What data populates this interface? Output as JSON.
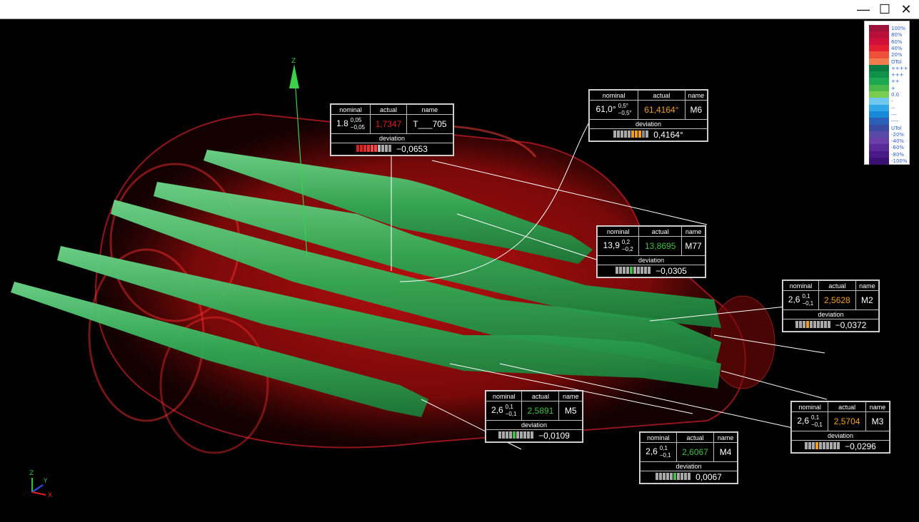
{
  "window": {
    "minimize_glyph": "—",
    "maximize_glyph": "☐",
    "close_glyph": "✕"
  },
  "legend": [
    {
      "label": "100%",
      "color": "#9c1238"
    },
    {
      "label": "80%",
      "color": "#b8103a"
    },
    {
      "label": "60%",
      "color": "#d0103a"
    },
    {
      "label": "40%",
      "color": "#e41e30"
    },
    {
      "label": "20%",
      "color": "#f0503a"
    },
    {
      "label": "OTol",
      "color": "#f47a50"
    },
    {
      "label": "++++",
      "color": "#0a7a40"
    },
    {
      "label": "+++",
      "color": "#109048"
    },
    {
      "label": "++",
      "color": "#1ca850"
    },
    {
      "label": "+",
      "color": "#4ab848"
    },
    {
      "label": "0.0",
      "color": "#7acc50"
    },
    {
      "label": "-",
      "color": "#70c8ee"
    },
    {
      "label": "--",
      "color": "#30a8e8"
    },
    {
      "label": "---",
      "color": "#1888d8"
    },
    {
      "label": "----",
      "color": "#2a60b8"
    },
    {
      "label": "UTol",
      "color": "#3a4aa0"
    },
    {
      "label": "-20%",
      "color": "#5a4aa8"
    },
    {
      "label": "-40%",
      "color": "#6a40a8"
    },
    {
      "label": "-60%",
      "color": "#5a2a98"
    },
    {
      "label": "-80%",
      "color": "#4a1a88"
    },
    {
      "label": "-100%",
      "color": "#3a1070"
    }
  ],
  "axes": {
    "z": "Z",
    "y": "Y",
    "x": "X",
    "main_z": "Z"
  },
  "callout_headers": {
    "nominal": "nominal",
    "actual": "actual",
    "name": "name",
    "deviation": "deviation"
  },
  "callouts": [
    {
      "id": "t705",
      "nominal": "1.8",
      "tol_up": "0,05",
      "tol_down": "−0,05",
      "actual": "1,7347",
      "actual_color": "#e02020",
      "name": "T___705",
      "deviation": "−0,0653",
      "bar": [
        "#c22",
        "#d22",
        "#e22",
        "#e33",
        "#f44",
        "#f44",
        "#bbb",
        "#aaa",
        "#aaa",
        "#999"
      ]
    },
    {
      "id": "m6",
      "nominal": "61,0°",
      "tol_up": "0,5°",
      "tol_down": "−0,5°",
      "actual": "61,4164°",
      "actual_color": "#f0a020",
      "name": "M6",
      "deviation": "0,4164°",
      "bar": [
        "#aaa",
        "#aaa",
        "#aaa",
        "#aaa",
        "#aaa",
        "#f0a020",
        "#f0a020",
        "#f0a020",
        "#888",
        "#aaa"
      ]
    },
    {
      "id": "m77",
      "nominal": "13,9",
      "tol_up": "0,2",
      "tol_down": "−0,2",
      "actual": "13,8695",
      "actual_color": "#40c040",
      "name": "M77",
      "deviation": "−0,0305",
      "bar": [
        "#aaa",
        "#aaa",
        "#aaa",
        "#aaa",
        "#40c040",
        "#aaa",
        "#aaa",
        "#aaa",
        "#aaa",
        "#aaa"
      ]
    },
    {
      "id": "m2",
      "nominal": "2,6",
      "tol_up": "0,1",
      "tol_down": "−0,1",
      "actual": "2,5628",
      "actual_color": "#f0a020",
      "name": "M2",
      "deviation": "−0,0372",
      "bar": [
        "#aaa",
        "#aaa",
        "#aaa",
        "#f0a020",
        "#aaa",
        "#aaa",
        "#aaa",
        "#aaa",
        "#aaa",
        "#aaa"
      ]
    },
    {
      "id": "m5",
      "nominal": "2,6",
      "tol_up": "0,1",
      "tol_down": "−0,1",
      "actual": "2,5891",
      "actual_color": "#40c040",
      "name": "M5",
      "deviation": "−0,0109",
      "bar": [
        "#aaa",
        "#aaa",
        "#aaa",
        "#aaa",
        "#40c040",
        "#aaa",
        "#aaa",
        "#aaa",
        "#aaa",
        "#aaa"
      ]
    },
    {
      "id": "m4",
      "nominal": "2,6",
      "tol_up": "0,1",
      "tol_down": "−0,1",
      "actual": "2,6067",
      "actual_color": "#40c040",
      "name": "M4",
      "deviation": "0,0067",
      "bar": [
        "#aaa",
        "#aaa",
        "#aaa",
        "#aaa",
        "#aaa",
        "#40c040",
        "#aaa",
        "#aaa",
        "#aaa",
        "#aaa"
      ]
    },
    {
      "id": "m3",
      "nominal": "2,6",
      "tol_up": "0,1",
      "tol_down": "−0,1",
      "actual": "2,5704",
      "actual_color": "#f0a020",
      "name": "M3",
      "deviation": "−0,0296",
      "bar": [
        "#aaa",
        "#aaa",
        "#aaa",
        "#f0a020",
        "#aaa",
        "#aaa",
        "#aaa",
        "#aaa",
        "#aaa",
        "#aaa"
      ]
    }
  ]
}
